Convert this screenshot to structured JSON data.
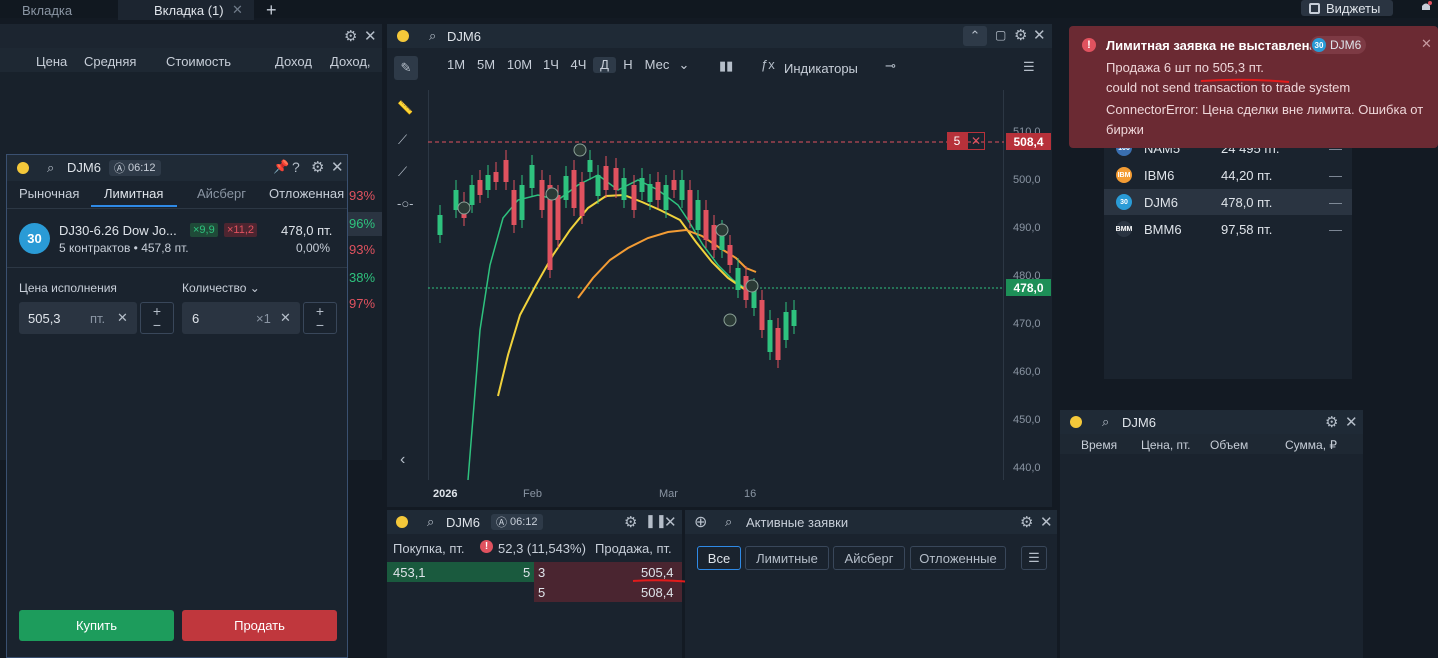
{
  "top_tabs": [
    "Вкладка",
    "Вкладка (1)"
  ],
  "widgets_label": "Виджеты",
  "portfolio": {
    "cols": [
      "Цена",
      "Средняя",
      "Стоимость",
      "Доход",
      "Доход,"
    ],
    "pcts": [
      "93%",
      "96%",
      "93%",
      "38%",
      "97%"
    ]
  },
  "order": {
    "ticker": "DJM6",
    "time": "06:12",
    "tabs": [
      "Рыночная",
      "Лимитная",
      "Айсберг",
      "Отложенная"
    ],
    "active_tab": "Лимитная",
    "logo": "30",
    "instrument": "DJ30-6.26 Dow Jo...",
    "tag_x_green": "×9,9",
    "tag_x_red": "×11,2",
    "price": "478,0 пт.",
    "contracts": "5 контрактов • 457,8 пт.",
    "change": "0,00%",
    "price_label": "Цена исполнения",
    "qty_label": "Количество",
    "price_value": "505,3",
    "price_unit": "пт.",
    "qty_value": "6",
    "qty_unit": "×1",
    "buy": "Купить",
    "sell": "Продать"
  },
  "chart": {
    "ticker": "DJM6",
    "timeframes": [
      "1М",
      "5М",
      "10М",
      "1Ч",
      "4Ч",
      "Д",
      "Н",
      "Мес"
    ],
    "active_timeframe": "Д",
    "indicators": "Индикаторы",
    "order_qty": "5",
    "order_price": "508,4",
    "last_price": "478,0",
    "y_ticks": [
      "510,0",
      "500,0",
      "490,0",
      "480,0",
      "470,0",
      "460,0",
      "450,0",
      "440,0"
    ],
    "x_ticks": [
      "2026",
      "Feb",
      "Mar",
      "16"
    ]
  },
  "orderbook": {
    "ticker": "DJM6",
    "time": "06:12",
    "buy_label": "Покупка, пт.",
    "spread": "52,3 (11,543%)",
    "sell_label": "Продажа, пт.",
    "bid_price": "453,1",
    "bid_qty": "5",
    "asks": [
      {
        "qty": "3",
        "price": "505,4"
      },
      {
        "qty": "5",
        "price": "508,4"
      }
    ]
  },
  "active_orders": {
    "title": "Активные заявки",
    "filters": [
      "Все",
      "Лимитные",
      "Айсберг",
      "Отложенные"
    ]
  },
  "notification": {
    "title": "Лимитная заявка не выставлена",
    "badge_logo": "30",
    "badge_ticker": "DJM6",
    "line1": "Продажа 6 шт по 505,3 пт.",
    "line2": "could not send transaction to trade system",
    "line3": "ConnectorError: Цена сделки вне лимита. Ошибка от биржи"
  },
  "watchlist": [
    {
      "ticker": "NAM5",
      "price": "24 495 пт.",
      "chg": "—"
    },
    {
      "ticker": "IBM6",
      "price": "44,20 пт.",
      "chg": "—"
    },
    {
      "ticker": "DJM6",
      "price": "478,0 пт.",
      "chg": "—"
    },
    {
      "ticker": "BMM6",
      "price": "97,58 пт.",
      "chg": "—"
    }
  ],
  "trades": {
    "ticker": "DJM6",
    "cols": [
      "Время",
      "Цена, пт.",
      "Объем",
      "Сумма, ₽"
    ]
  }
}
